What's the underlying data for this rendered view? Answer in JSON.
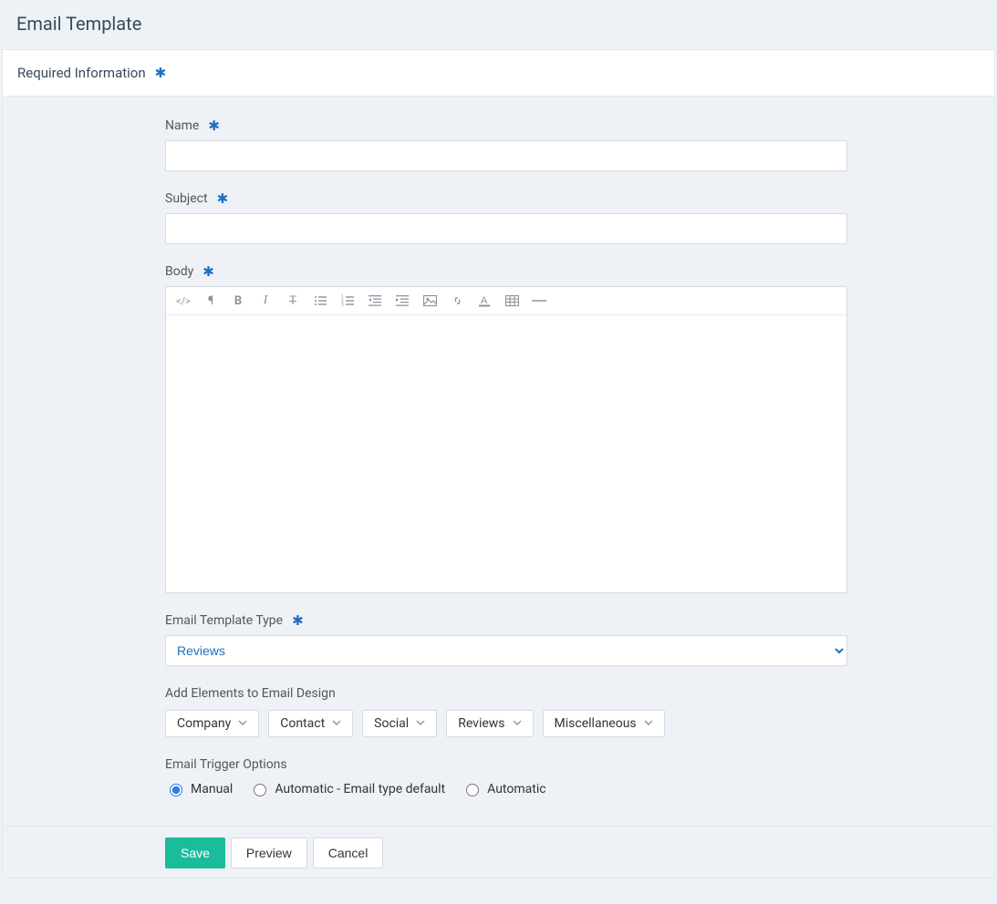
{
  "page_title": "Email Template",
  "section_header": "Required Information",
  "fields": {
    "name": {
      "label": "Name",
      "value": ""
    },
    "subject": {
      "label": "Subject",
      "value": ""
    },
    "body": {
      "label": "Body",
      "value": ""
    },
    "template_type": {
      "label": "Email Template Type",
      "selected": "Reviews"
    },
    "add_elements_label": "Add Elements to Email Design",
    "trigger_label": "Email Trigger Options"
  },
  "toolbar_icons": [
    "code",
    "paragraph",
    "bold",
    "italic",
    "strikethrough",
    "list-ul",
    "list-ol",
    "outdent",
    "indent",
    "image",
    "link",
    "text-color",
    "table",
    "hr"
  ],
  "element_dropdowns": [
    {
      "label": "Company"
    },
    {
      "label": "Contact"
    },
    {
      "label": "Social"
    },
    {
      "label": "Reviews"
    },
    {
      "label": "Miscellaneous"
    }
  ],
  "trigger_options": [
    {
      "label": "Manual",
      "checked": true
    },
    {
      "label": "Automatic - Email type default",
      "checked": false
    },
    {
      "label": "Automatic",
      "checked": false
    }
  ],
  "footer": {
    "save": "Save",
    "preview": "Preview",
    "cancel": "Cancel"
  },
  "required_marker": "✱"
}
